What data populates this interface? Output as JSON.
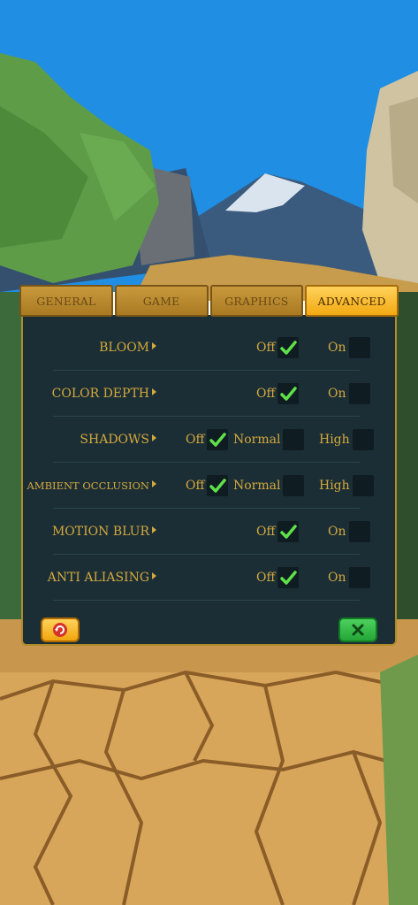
{
  "tabs": [
    {
      "label": "GENERAL",
      "active": false
    },
    {
      "label": "GAME",
      "active": false
    },
    {
      "label": "GRAPHICS",
      "active": false
    },
    {
      "label": "ADVANCED",
      "active": true
    }
  ],
  "settings": [
    {
      "label": "BLOOM",
      "options": [
        {
          "label": "Off",
          "checked": true
        },
        {
          "label": "On",
          "checked": false
        }
      ]
    },
    {
      "label": "COLOR DEPTH",
      "options": [
        {
          "label": "Off",
          "checked": true
        },
        {
          "label": "On",
          "checked": false
        }
      ]
    },
    {
      "label": "SHADOWS",
      "options": [
        {
          "label": "Off",
          "checked": true
        },
        {
          "label": "Normal",
          "checked": false
        },
        {
          "label": "High",
          "checked": false
        }
      ]
    },
    {
      "label": "AMBIENT OCCLUSION",
      "options": [
        {
          "label": "Off",
          "checked": true
        },
        {
          "label": "Normal",
          "checked": false
        },
        {
          "label": "High",
          "checked": false
        }
      ]
    },
    {
      "label": "MOTION BLUR",
      "options": [
        {
          "label": "Off",
          "checked": true
        },
        {
          "label": "On",
          "checked": false
        }
      ]
    },
    {
      "label": "ANTI ALIASING",
      "options": [
        {
          "label": "Off",
          "checked": true
        },
        {
          "label": "On",
          "checked": false
        }
      ]
    }
  ],
  "footer": {
    "reset_icon": "reset-icon",
    "confirm_icon": "close-x-icon"
  },
  "colors": {
    "panel_bg": "#1b2e36",
    "label_gold": "#d4a93c",
    "check_green": "#5fe04a",
    "tab_active": "#f2a912",
    "tab_inactive": "#b0822a"
  }
}
